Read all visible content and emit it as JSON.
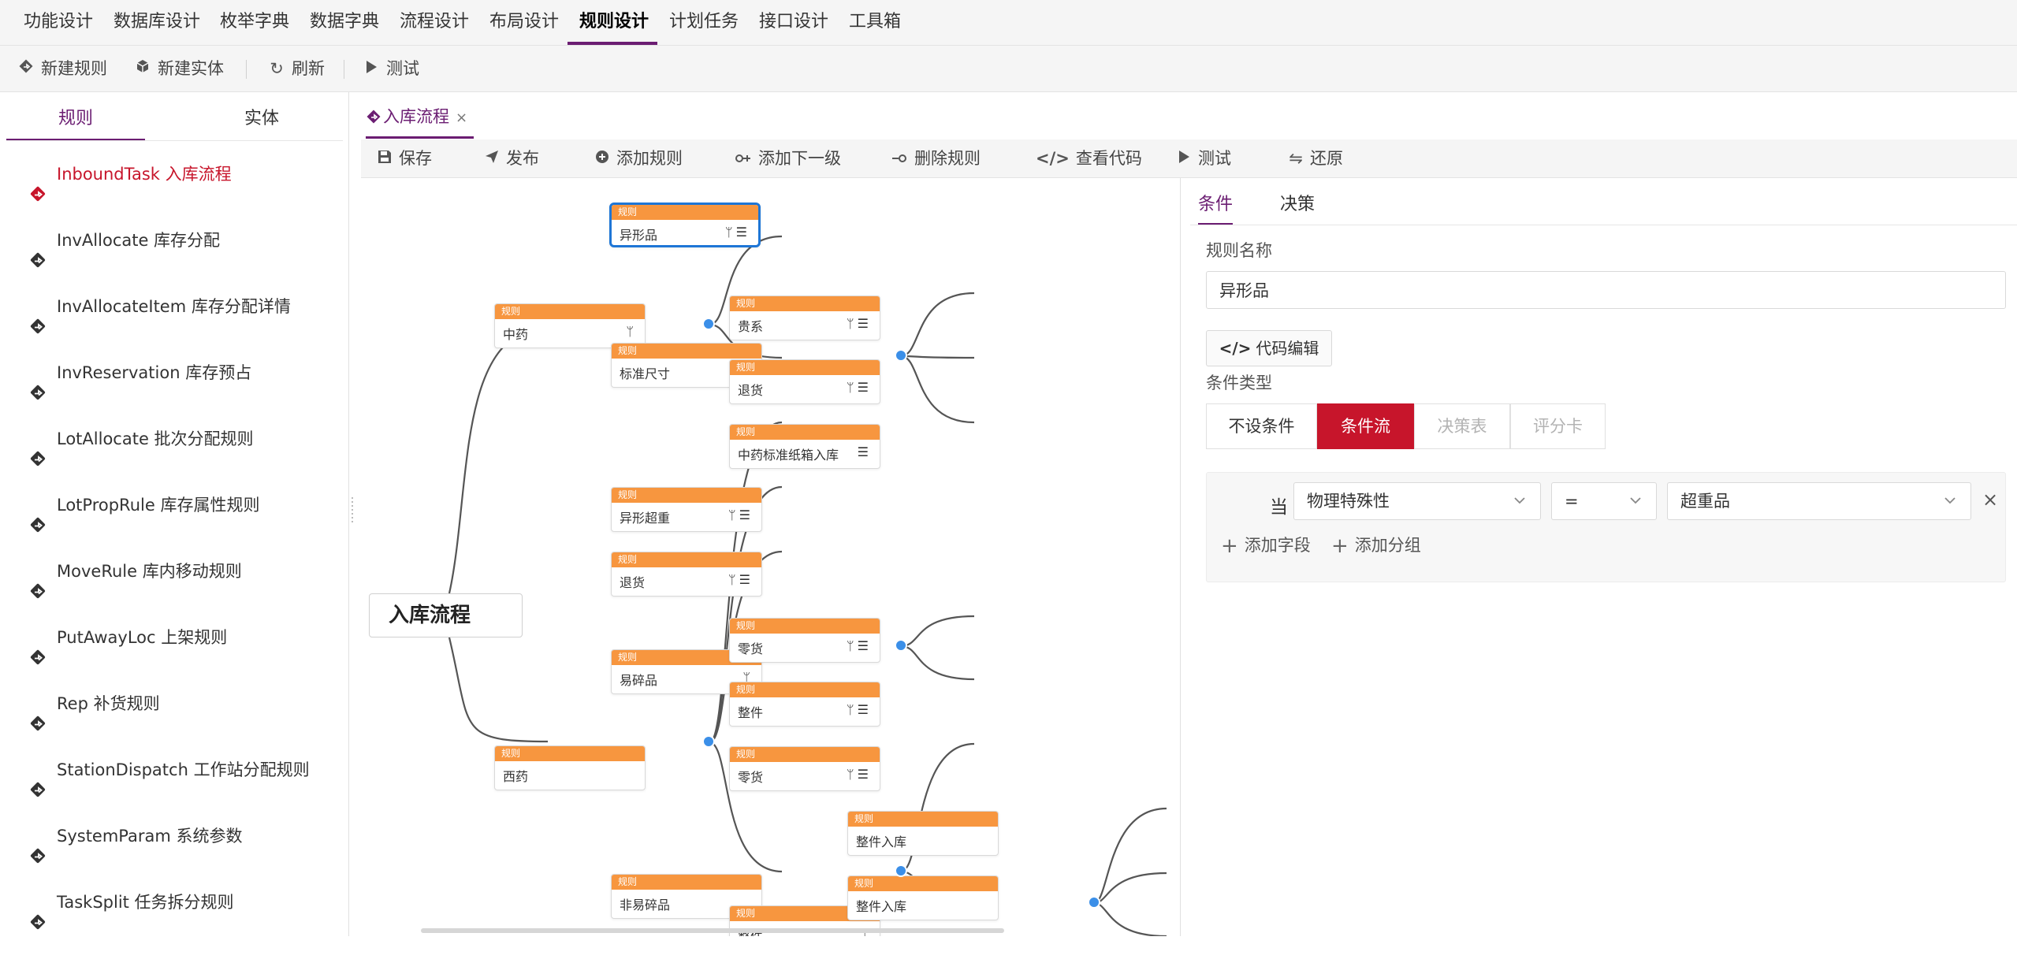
{
  "top_nav": {
    "items": [
      "功能设计",
      "数据库设计",
      "枚举字典",
      "数据字典",
      "流程设计",
      "布局设计",
      "规则设计",
      "计划任务",
      "接口设计",
      "工具箱"
    ],
    "active_index": 6
  },
  "toolbar": {
    "new_rule": "新建规则",
    "new_entity": "新建实体",
    "refresh": "刷新",
    "test": "测试"
  },
  "left_panel": {
    "tabs": [
      "规则",
      "实体"
    ],
    "rules": [
      "InboundTask 入库流程",
      "InvAllocate 库存分配",
      "InvAllocateItem 库存分配详情",
      "InvReservation 库存预占",
      "LotAllocate 批次分配规则",
      "LotPropRule 库存属性规则",
      "MoveRule 库内移动规则",
      "PutAwayLoc 上架规则",
      "Rep 补货规则",
      "StationDispatch 工作站分配规则",
      "SystemParam 系统参数",
      "TaskSplit 任务拆分规则"
    ],
    "active_index": 0
  },
  "editor": {
    "doc_tab": "入库流程",
    "close": "×",
    "toolbar": {
      "save": "保存",
      "publish": "发布",
      "add_rule": "添加规则",
      "add_child": "添加下一级",
      "delete_rule": "删除规则",
      "view_code": "查看代码",
      "test": "测试",
      "restore": "还原"
    }
  },
  "flow": {
    "root": "入库流程",
    "node_header": "规则",
    "nodes": [
      {
        "id": "n1",
        "label": "异形品",
        "icons": "ᛘ☰"
      },
      {
        "id": "n2",
        "label": "中药",
        "icons": "ᛘ"
      },
      {
        "id": "n3",
        "label": "标准尺寸",
        "icons": ""
      },
      {
        "id": "n4",
        "label": "贵系",
        "icons": "ᛘ☰"
      },
      {
        "id": "n5",
        "label": "退货",
        "icons": "ᛘ☰"
      },
      {
        "id": "n6",
        "label": "中药标准纸箱入库",
        "icons": "☰"
      },
      {
        "id": "n7",
        "label": "异形超重",
        "icons": "ᛘ☰"
      },
      {
        "id": "n8",
        "label": "退货",
        "icons": "ᛘ☰"
      },
      {
        "id": "n9",
        "label": "易碎品",
        "icons": "ᛘ"
      },
      {
        "id": "n10",
        "label": "零货",
        "icons": "ᛘ☰"
      },
      {
        "id": "n11",
        "label": "整件",
        "icons": "ᛘ☰"
      },
      {
        "id": "n12",
        "label": "零货",
        "icons": "ᛘ☰"
      },
      {
        "id": "n13",
        "label": "西药",
        "icons": ""
      },
      {
        "id": "n14",
        "label": "非易碎品",
        "icons": ""
      },
      {
        "id": "n15",
        "label": "整件",
        "icons": "ᛘ"
      },
      {
        "id": "n16",
        "label": "整件入库",
        "icons": ""
      },
      {
        "id": "n17",
        "label": "整件入库",
        "icons": ""
      },
      {
        "id": "n18",
        "label": "",
        "icons": ""
      }
    ]
  },
  "right_panel": {
    "tabs": [
      "条件",
      "决策"
    ],
    "rule_name_label": "规则名称",
    "rule_name_value": "异形品",
    "code_edit": "代码编辑",
    "condition_type_label": "条件类型",
    "condition_types": [
      "不设条件",
      "条件流",
      "决策表",
      "评分卡"
    ],
    "condition_type_active": 1,
    "condition": {
      "when": "当",
      "field": "物理特殊性",
      "operator": "=",
      "value": "超重品",
      "remove": "×"
    },
    "add_field": "添加字段",
    "add_group": "添加分组"
  },
  "colors": {
    "brand": "#6b1d72",
    "accent_red": "#c7152b",
    "node_header": "#f7963f",
    "connector_dot": "#3b8fe8",
    "selected_border": "#1e76d6"
  }
}
